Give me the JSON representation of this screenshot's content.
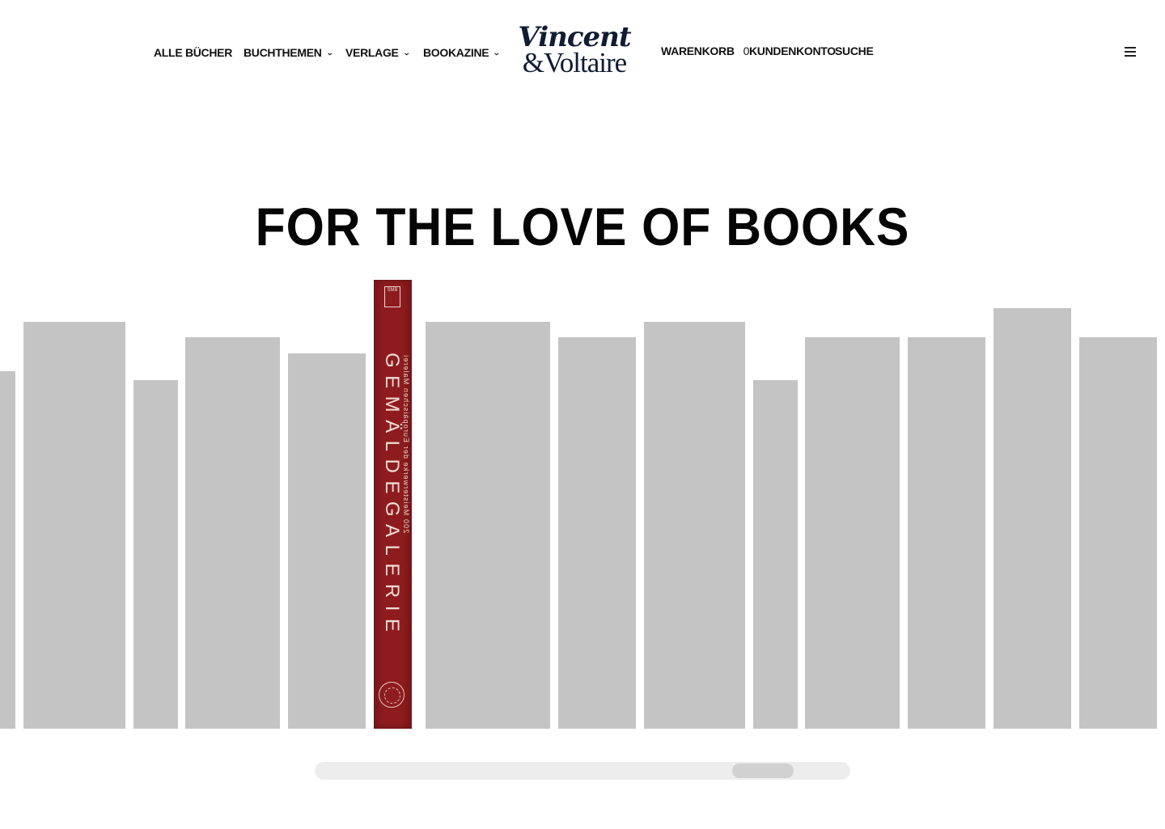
{
  "nav": {
    "left": [
      {
        "label": "ALLE BÜCHER",
        "dropdown": false
      },
      {
        "label": "BUCHTHEMEN",
        "dropdown": true
      },
      {
        "label": "VERLAGE",
        "dropdown": true
      },
      {
        "label": "BOOKAZINE",
        "dropdown": true
      }
    ],
    "right": {
      "cart_label": "WARENKORB",
      "cart_count": "0",
      "account_label": "KUNDENKONTO",
      "search_label": "SUCHE"
    },
    "chevron_icon": "chevron-down-icon",
    "menu_icon": "hamburger-menu-icon"
  },
  "logo": {
    "line1": "Vincent",
    "line2": "&Voltaire",
    "color": "#101c33"
  },
  "hero": {
    "title": "FOR THE LOVE OF BOOKS"
  },
  "featured_book": {
    "title": "GEMÄLDEGALERIE",
    "subtitle": "200 Meisterwerke der Europäischen Malerei",
    "publisher_mark": "SMB",
    "spine_color": "#8e1c1f"
  },
  "placeholder_color": "#c4c4c4",
  "scrollbar": {
    "position_fraction": 0.88,
    "thumb_fraction": 0.115
  }
}
